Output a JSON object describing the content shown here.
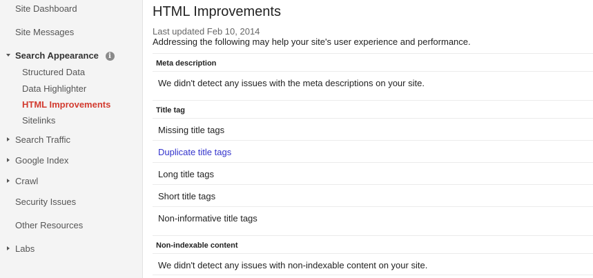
{
  "sidebar": {
    "site_dashboard": "Site Dashboard",
    "site_messages": "Site Messages",
    "search_appearance": "Search Appearance",
    "search_appearance_info": "i",
    "structured_data": "Structured Data",
    "data_highlighter": "Data Highlighter",
    "html_improvements": "HTML Improvements",
    "sitelinks": "Sitelinks",
    "search_traffic": "Search Traffic",
    "google_index": "Google Index",
    "crawl": "Crawl",
    "security_issues": "Security Issues",
    "other_resources": "Other Resources",
    "labs": "Labs"
  },
  "main": {
    "title": "HTML Improvements",
    "last_updated": "Last updated Feb 10, 2014",
    "description": "Addressing the following may help your site's user experience and performance.",
    "meta_section": {
      "heading": "Meta description",
      "message": "We didn't detect any issues with the meta descriptions on your site."
    },
    "title_section": {
      "heading": "Title tag",
      "items": [
        "Missing title tags",
        "Duplicate title tags",
        "Long title tags",
        "Short title tags",
        "Non-informative title tags"
      ]
    },
    "nonindexable_section": {
      "heading": "Non-indexable content",
      "message": "We didn't detect any issues with non-indexable content on your site."
    }
  },
  "colors": {
    "active_nav": "#d23b2f",
    "link": "#3333cc",
    "sidebar_bg": "#f4f4f4"
  }
}
